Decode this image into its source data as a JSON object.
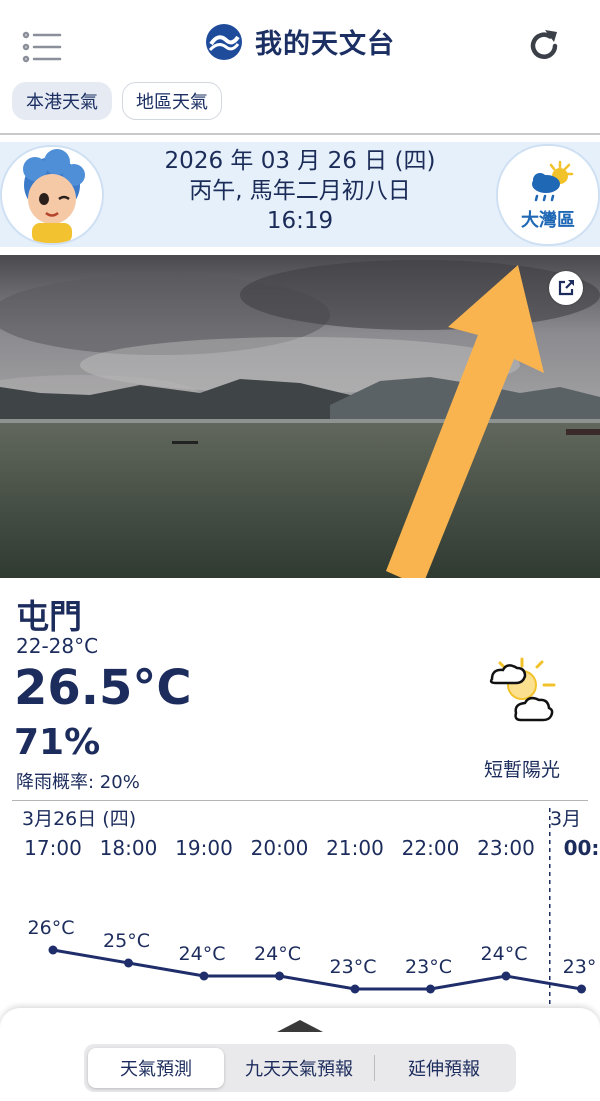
{
  "header": {
    "title": "我的天文台",
    "icons": {
      "menu": "menu-icon",
      "logo": "hko-logo-icon",
      "refresh": "refresh-icon"
    }
  },
  "tabs": [
    {
      "label": "本港天氣",
      "active": true
    },
    {
      "label": "地區天氣",
      "active": false
    }
  ],
  "date_banner": {
    "date": "2026 年 03 月 26 日 (四)",
    "lunar": "丙午, 馬年二月初八日",
    "time": "16:19",
    "gba_label": "大灣區"
  },
  "current": {
    "location": "屯門",
    "temp_range": "22-28°C",
    "temperature": "26.5°C",
    "humidity": "71%",
    "rain_probability": "降雨概率: 20%",
    "description": "短暫陽光",
    "weather_icon": "sunny-periods-icon"
  },
  "hourly": {
    "date_label": "3月26日 (四)",
    "next_date_label": "3月",
    "hours": [
      {
        "time": "17:00",
        "temp": "26°C",
        "value": 26
      },
      {
        "time": "18:00",
        "temp": "25°C",
        "value": 25
      },
      {
        "time": "19:00",
        "temp": "24°C",
        "value": 24
      },
      {
        "time": "20:00",
        "temp": "24°C",
        "value": 24
      },
      {
        "time": "21:00",
        "temp": "23°C",
        "value": 23
      },
      {
        "time": "22:00",
        "temp": "23°C",
        "value": 23
      },
      {
        "time": "23:00",
        "temp": "24°C",
        "value": 24
      },
      {
        "time": "00:",
        "temp": "23°",
        "value": 23
      }
    ]
  },
  "bottom_nav": {
    "items": [
      "天氣預測",
      "九天天氣預報",
      "延伸預報"
    ],
    "active_index": 0
  },
  "colors": {
    "brand_navy": "#1c2c5c",
    "banner_bg": "#e6f0fb",
    "gba_blue": "#1f68b5",
    "arrow": "#f9b44f"
  }
}
